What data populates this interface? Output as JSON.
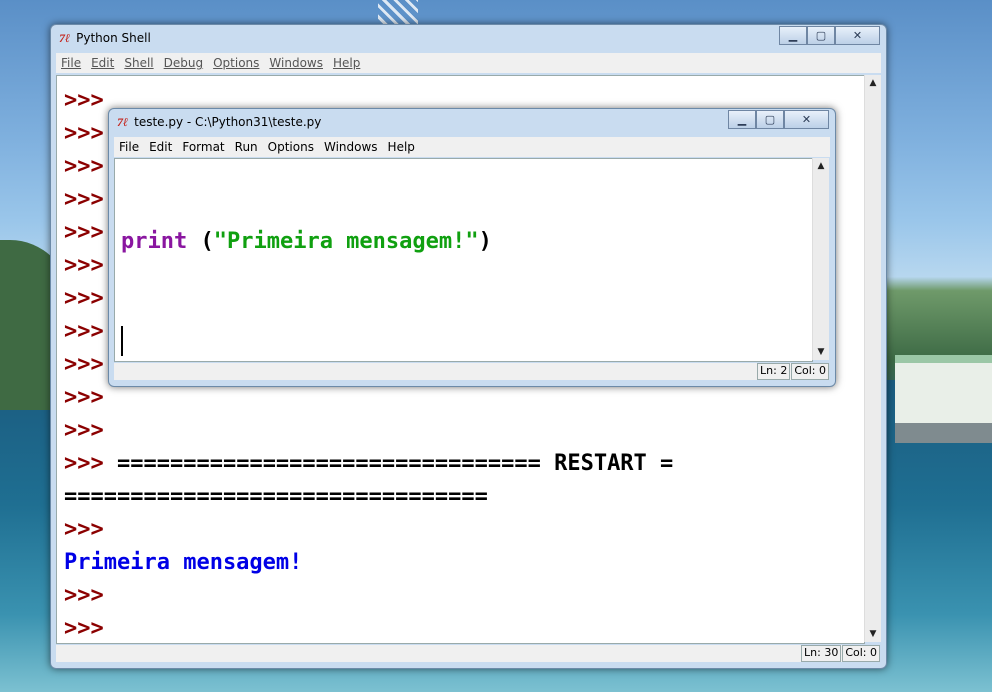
{
  "shell": {
    "title": "Python Shell",
    "menu": [
      "File",
      "Edit",
      "Shell",
      "Debug",
      "Options",
      "Windows",
      "Help"
    ],
    "lines": [
      {
        "type": "prompt",
        "text": ">>>"
      },
      {
        "type": "prompt",
        "text": ">>>"
      },
      {
        "type": "prompt",
        "text": ">>>"
      },
      {
        "type": "prompt",
        "text": ">>>"
      },
      {
        "type": "prompt",
        "text": ">>>"
      },
      {
        "type": "prompt",
        "text": ">>>"
      },
      {
        "type": "prompt",
        "text": ">>>"
      },
      {
        "type": "prompt",
        "text": ">>>"
      },
      {
        "type": "prompt",
        "text": ">>>"
      },
      {
        "type": "prompt",
        "text": ">>>"
      },
      {
        "type": "prompt",
        "text": ">>>"
      },
      {
        "type": "restart",
        "prompt": ">>>",
        "text": " ================================ RESTART ="
      },
      {
        "type": "plain",
        "text": "================================"
      },
      {
        "type": "prompt",
        "text": ">>>"
      },
      {
        "type": "output",
        "text": "Primeira mensagem!"
      },
      {
        "type": "prompt",
        "text": ">>>"
      },
      {
        "type": "prompt",
        "text": ">>>"
      }
    ],
    "status": {
      "ln": "Ln: 30",
      "col": "Col: 0"
    }
  },
  "editor": {
    "title": "teste.py - C:\\Python31\\teste.py",
    "menu": [
      "File",
      "Edit",
      "Format",
      "Run",
      "Options",
      "Windows",
      "Help"
    ],
    "code": {
      "keyword": "print",
      "open": " (",
      "string": "\"Primeira mensagem!\"",
      "close": ")"
    },
    "status": {
      "ln": "Ln: 2",
      "col": "Col: 0"
    }
  },
  "icons": {
    "app": "python-tk-icon",
    "min": "minimize-icon",
    "max": "maximize-icon",
    "close": "close-icon"
  },
  "colors": {
    "prompt": "#8b0000",
    "output": "#0000e6",
    "keyword": "#8a16a0",
    "string": "#10a010"
  }
}
